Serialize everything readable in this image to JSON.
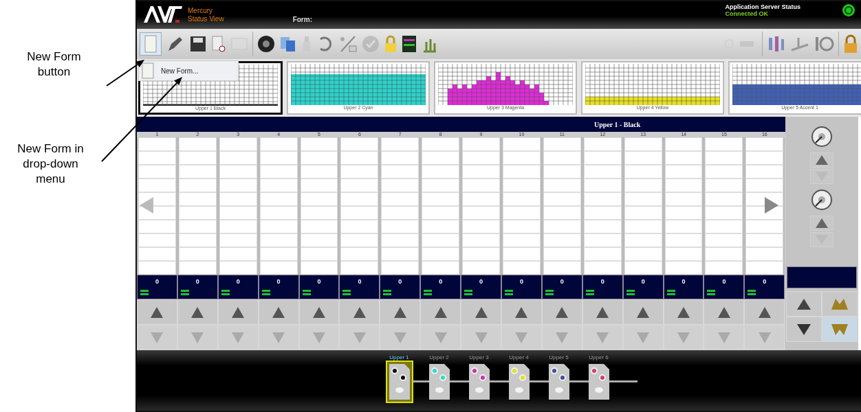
{
  "annotations": [
    {
      "text": "New Form button"
    },
    {
      "text": "New Form in drop-down menu"
    }
  ],
  "header": {
    "app_name": "Mercury",
    "view_name": "Status View",
    "form_label": "Form:",
    "server_status_label": "Application Server Status",
    "server_status": "Connected OK"
  },
  "dropdown": {
    "items": [
      "New Form..."
    ]
  },
  "thumbnails": [
    {
      "label": "Upper 1 Black",
      "color": "#202020",
      "selected": true
    },
    {
      "label": "Upper 2 Cyan",
      "color": "#2ad4cc",
      "selected": false
    },
    {
      "label": "Upper 3 Magenta",
      "color": "#e02ad8",
      "selected": false
    },
    {
      "label": "Upper 4 Yellow",
      "color": "#e8e020",
      "selected": false
    },
    {
      "label": "Upper 5 Accent 1",
      "color": "#4060b8",
      "selected": false
    }
  ],
  "zones": {
    "title": "Upper 1 - Black",
    "columns": [
      {
        "number": "1",
        "value": "0"
      },
      {
        "number": "2",
        "value": "0"
      },
      {
        "number": "3",
        "value": "0"
      },
      {
        "number": "4",
        "value": "0"
      },
      {
        "number": "5",
        "value": "0"
      },
      {
        "number": "6",
        "value": "0"
      },
      {
        "number": "7",
        "value": "0"
      },
      {
        "number": "8",
        "value": "0"
      },
      {
        "number": "9",
        "value": "0"
      },
      {
        "number": "10",
        "value": "0"
      },
      {
        "number": "11",
        "value": "0"
      },
      {
        "number": "12",
        "value": "0"
      },
      {
        "number": "13",
        "value": "0"
      },
      {
        "number": "14",
        "value": "0"
      },
      {
        "number": "15",
        "value": "0"
      },
      {
        "number": "16",
        "value": "0"
      }
    ]
  },
  "units": [
    {
      "label": "Upper 1",
      "color": "#101010",
      "selected": true
    },
    {
      "label": "Upper 2",
      "color": "#30d8d0",
      "selected": false
    },
    {
      "label": "Upper 3",
      "color": "#d030b0",
      "selected": false
    },
    {
      "label": "Upper 4",
      "color": "#e0e020",
      "selected": false
    },
    {
      "label": "Upper 5",
      "color": "#4050a0",
      "selected": false
    },
    {
      "label": "Upper 6",
      "color": "#d04070",
      "selected": false
    }
  ]
}
